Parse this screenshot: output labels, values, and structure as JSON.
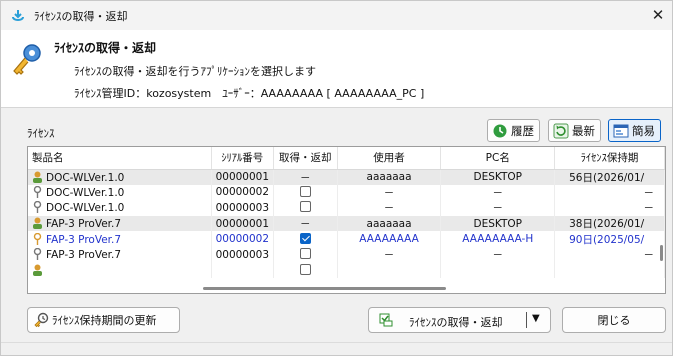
{
  "window": {
    "title": "ﾗｲｾﾝｽの取得・返却",
    "close_glyph": "✕"
  },
  "header": {
    "title": "ﾗｲｾﾝｽの取得・返却",
    "description": "ﾗｲｾﾝｽの取得・返却を行うｱﾌﾟﾘｹｰｼｮﾝを選択します",
    "management": "ﾗｲｾﾝｽ管理ID：kozosystem　ﾕｰｻﾞｰ：AAAAAAAA [ AAAAAAAA_PC ]"
  },
  "license_section": {
    "label": "ﾗｲｾﾝｽ"
  },
  "toolbar": {
    "history_label": "履歴",
    "refresh_label": "最新",
    "simple_label": "簡易"
  },
  "table": {
    "columns": [
      "製品名",
      "ｼﾘｱﾙ番号",
      "取得・返却",
      "使用者",
      "PC名",
      "ﾗｲｾﾝｽ保持期"
    ],
    "rows": [
      {
        "product": "DOC-WLVer.1.0",
        "serial": "00000001",
        "action": "－",
        "user": "aaaaaaa",
        "pc": "DESKTOP",
        "days": "56日(2026/01/"
      },
      {
        "product": "DOC-WLVer.1.0",
        "serial": "00000002",
        "action": "",
        "user": "－",
        "pc": "－",
        "days": "－"
      },
      {
        "product": "DOC-WLVer.1.0",
        "serial": "00000003",
        "action": "",
        "user": "－",
        "pc": "－",
        "days": "－"
      },
      {
        "product": "FAP-3 ProVer.7",
        "serial": "00000001",
        "action": "－",
        "user": "aaaaaaa",
        "pc": "DESKTOP",
        "days": "38日(2026/01/"
      },
      {
        "product": "FAP-3 ProVer.7",
        "serial": "00000002",
        "action": "",
        "user": "AAAAAAAA",
        "pc": "AAAAAAAA-H",
        "days": "90日(2025/05/"
      },
      {
        "product": "FAP-3 ProVer.7",
        "serial": "00000003",
        "action": "",
        "user": "－",
        "pc": "－",
        "days": "－"
      },
      {
        "product": "",
        "serial": "",
        "action": "",
        "user": "",
        "pc": "",
        "days": ""
      }
    ]
  },
  "buttons": {
    "renew_label": "ﾗｲｾﾝｽ保持期間の更新",
    "acquire_label": "ﾗｲｾﾝｽの取得・返却",
    "dropdown_glyph": "▼",
    "close_label": "閉じる"
  },
  "colors": {
    "accent": "#0a64c8",
    "selected_text": "#2233cc",
    "row_highlight": "#e9e9e9"
  }
}
